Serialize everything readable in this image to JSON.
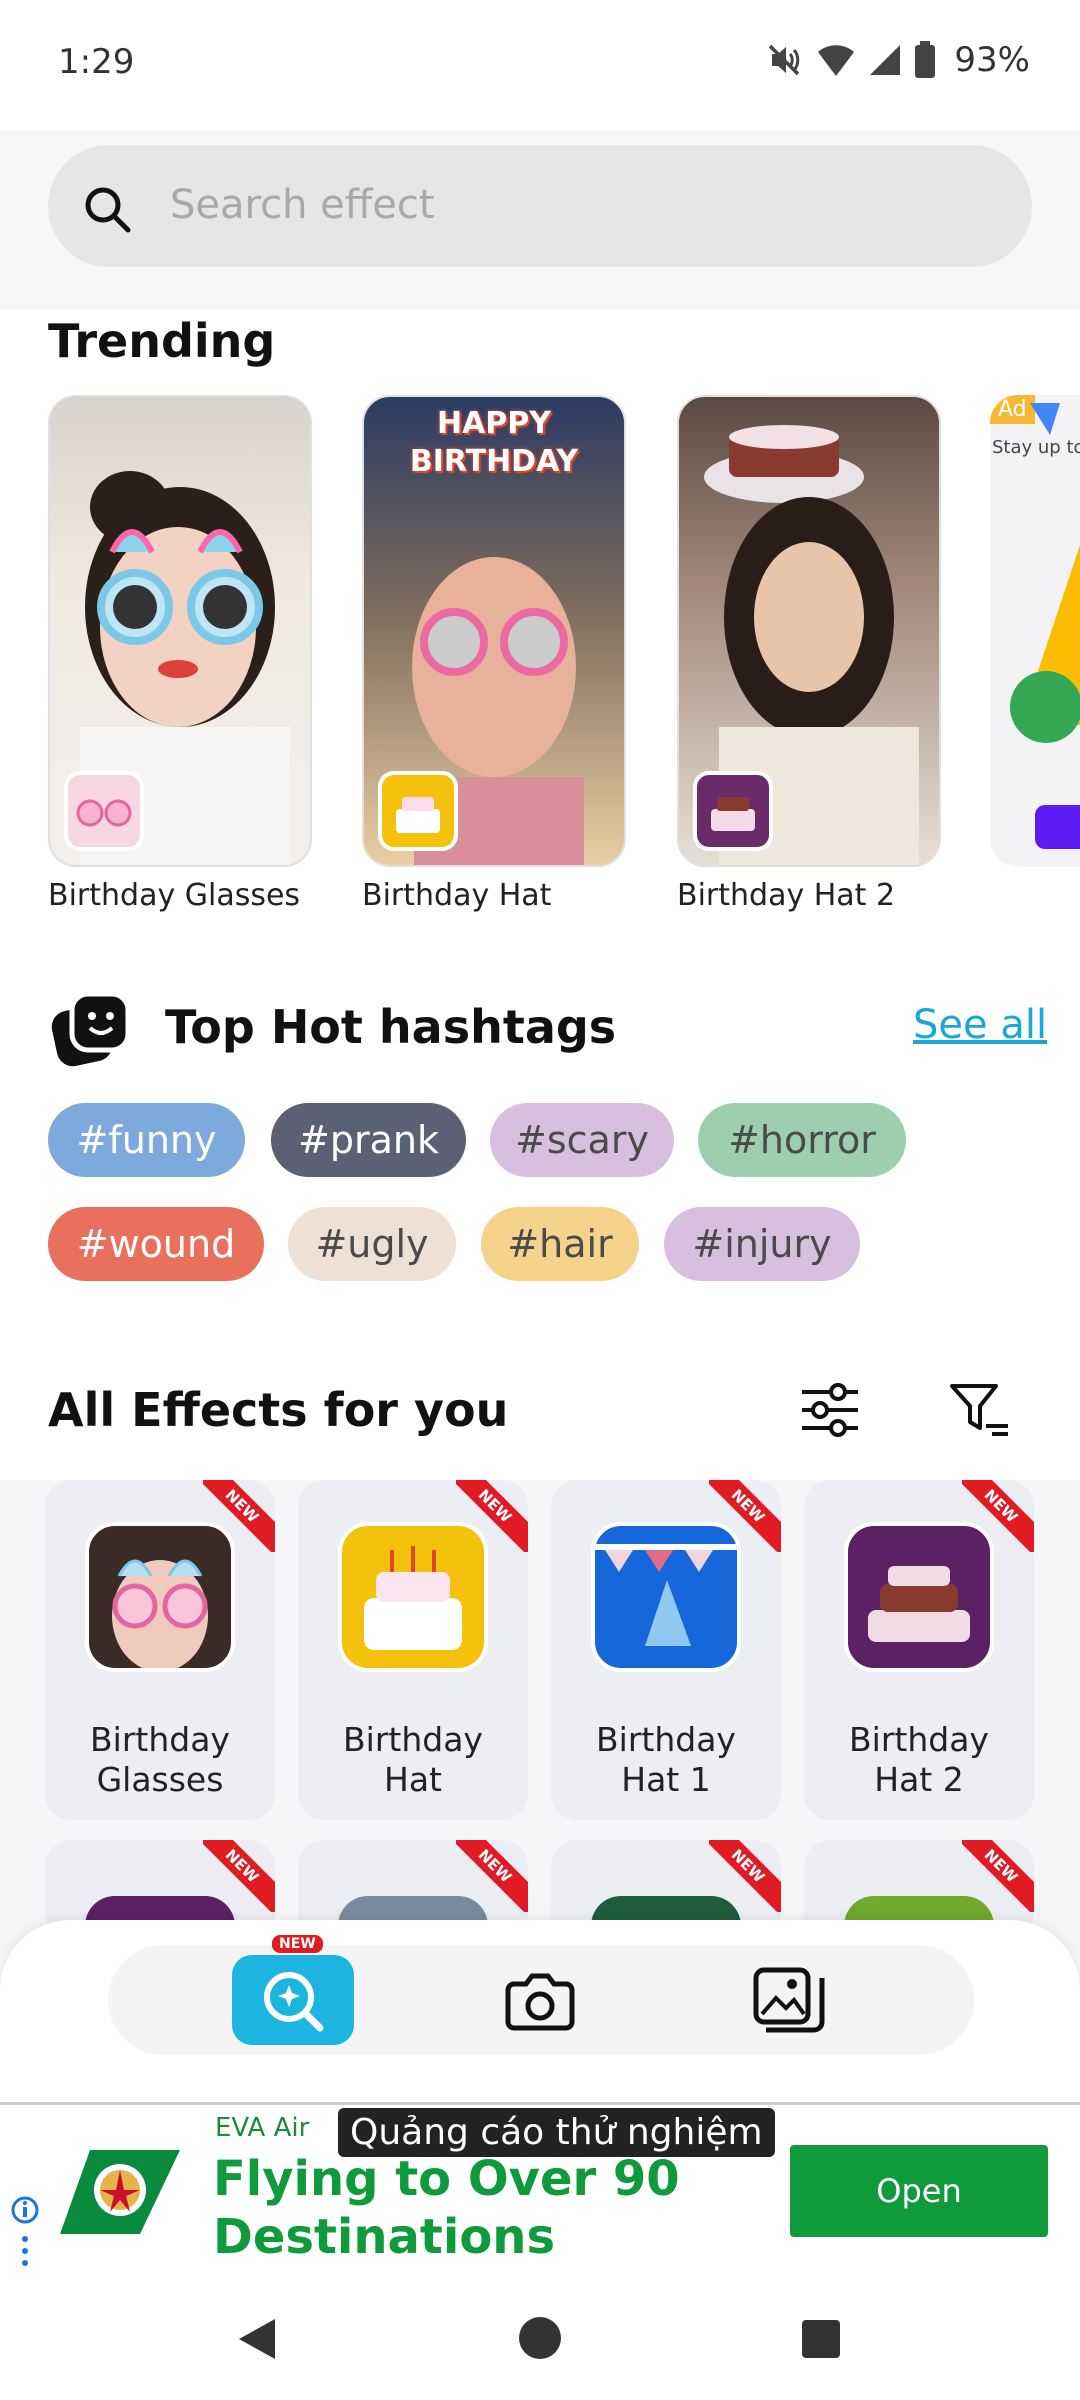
{
  "status": {
    "time": "1:29",
    "battery": "93%"
  },
  "search": {
    "placeholder": "Search effect"
  },
  "trending": {
    "title": "Trending",
    "items": [
      {
        "label": "Birthday Glasses"
      },
      {
        "label": "Birthday Hat",
        "banner": "HAPPY BIRTHDAY"
      },
      {
        "label": "Birthday Hat 2"
      }
    ],
    "ad": {
      "badge": "Ad",
      "text": "Stay up to"
    }
  },
  "hashtags": {
    "title": "Top Hot hashtags",
    "see_all": "See all",
    "tags": [
      "#funny",
      "#prank",
      "#scary",
      "#horror",
      "#wound",
      "#ugly",
      "#hair",
      "#injury"
    ]
  },
  "effects": {
    "title": "All Effects for you",
    "ribbon": "NEW",
    "items": [
      {
        "line1": "Birthday",
        "line2": "Glasses"
      },
      {
        "line1": "Birthday",
        "line2": "Hat"
      },
      {
        "line1": "Birthday",
        "line2": "Hat 1"
      },
      {
        "line1": "Birthday",
        "line2": "Hat 2"
      }
    ]
  },
  "nav": {
    "new_badge": "NEW"
  },
  "ad_banner": {
    "advertiser": "EVA Air",
    "overlay": "Quảng cáo thử nghiệm",
    "headline": "Flying to Over 90 Destinations",
    "cta": "Open"
  },
  "colors": {
    "accent": "#1db4e0",
    "ad_green": "#0f9a3c",
    "new_red": "#e01b24"
  }
}
